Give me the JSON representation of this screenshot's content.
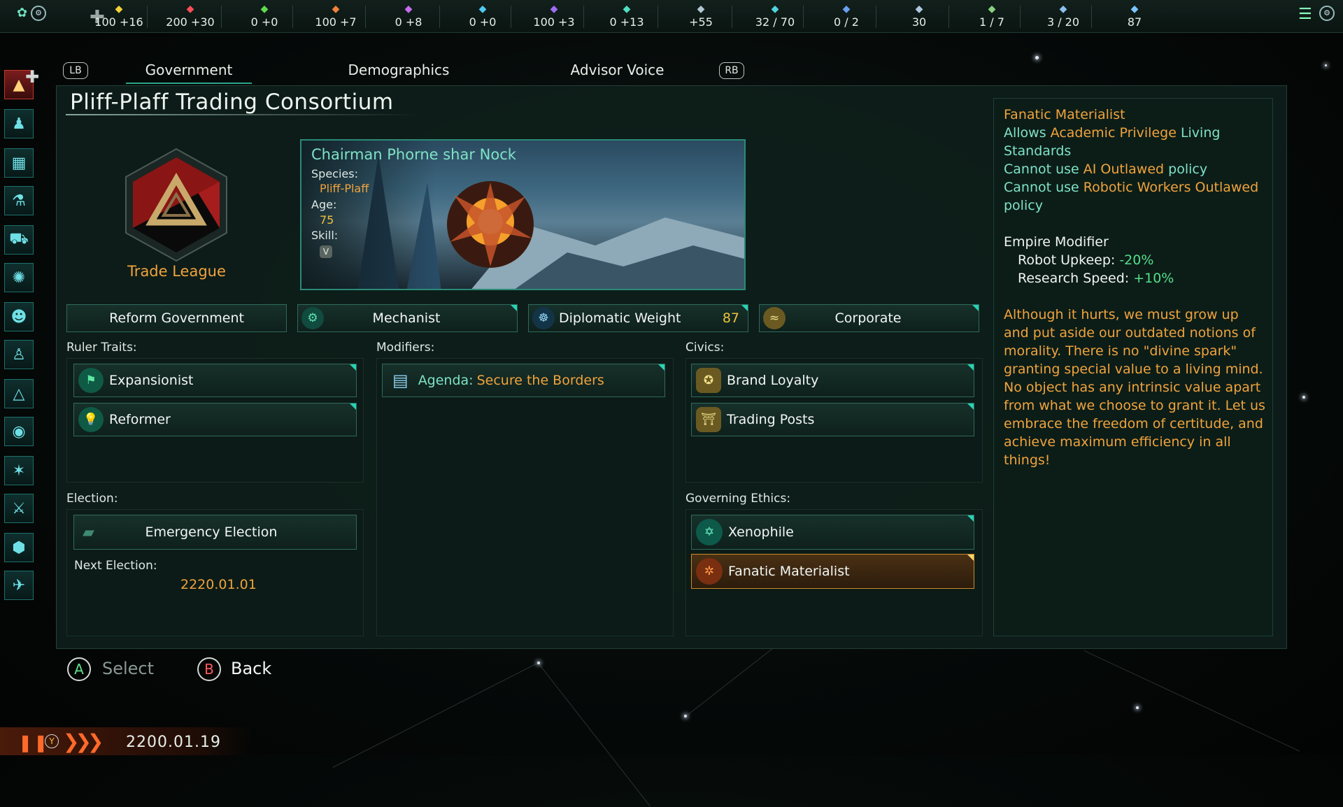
{
  "topbar": {
    "resources": [
      {
        "icon": "energy-icon",
        "value": "100 +16",
        "color": "#f3d23a"
      },
      {
        "icon": "minerals-icon",
        "value": "200 +30",
        "color": "#ff4d57"
      },
      {
        "icon": "food-icon",
        "value": "0 +0",
        "color": "#5fdc4d"
      },
      {
        "icon": "consumer-goods-icon",
        "value": "100 +7",
        "color": "#f0823a"
      },
      {
        "icon": "alloys-icon",
        "value": "0 +8",
        "color": "#c86cf0"
      },
      {
        "icon": "exotic-gases-icon",
        "value": "0 +0",
        "color": "#4fc9f2"
      },
      {
        "icon": "influence-icon",
        "value": "100 +3",
        "color": "#9f6cf7"
      },
      {
        "icon": "unity-icon",
        "value": "0 +13",
        "color": "#4fe0c0"
      },
      {
        "icon": "research-icon",
        "value": "+55",
        "color": "#b0c8d0"
      },
      {
        "icon": "naval-capacity-icon",
        "value": "32 / 70",
        "color": "#4fd4e0"
      },
      {
        "icon": "starbase-icon",
        "value": "0 / 2",
        "color": "#6aa0f0"
      },
      {
        "icon": "pops-icon",
        "value": "30",
        "color": "#b0c8e0"
      },
      {
        "icon": "envoys-icon",
        "value": "1 / 7",
        "color": "#8ad080"
      },
      {
        "icon": "fleets-icon",
        "value": "3 / 20",
        "color": "#8cc0f0"
      },
      {
        "icon": "stability-icon",
        "value": "87",
        "color": "#7cc4ff"
      }
    ]
  },
  "tabs": {
    "lb": "LB",
    "rb": "RB",
    "items": [
      {
        "label": "Government"
      },
      {
        "label": "Demographics"
      },
      {
        "label": "Advisor Voice"
      }
    ]
  },
  "empire": {
    "name": "Pliff-Plaff Trading Consortium",
    "authority": "Trade League"
  },
  "ruler": {
    "title": "Chairman Phorne shar Nock",
    "species_label": "Species:",
    "species": "Pliff-Plaff",
    "age_label": "Age:",
    "age": "75",
    "skill_label": "Skill:",
    "skill": "V"
  },
  "actions": {
    "reform": "Reform Government",
    "mechanist": "Mechanist",
    "diplomatic_weight_label": "Diplomatic Weight",
    "diplomatic_weight": "87",
    "corporate": "Corporate"
  },
  "sections": {
    "ruler_traits_label": "Ruler Traits:",
    "ruler_traits": [
      {
        "label": "Expansionist"
      },
      {
        "label": "Reformer"
      }
    ],
    "modifiers_label": "Modifiers:",
    "modifier_prefix": "Agenda:",
    "modifier_value": "Secure the Borders",
    "civics_label": "Civics:",
    "civics": [
      {
        "label": "Brand Loyalty"
      },
      {
        "label": "Trading Posts"
      }
    ],
    "election_label": "Election:",
    "election_button": "Emergency Election",
    "next_election_label": "Next Election:",
    "next_election": "2220.01.01",
    "ethics_label": "Governing Ethics:",
    "ethics": [
      {
        "label": "Xenophile"
      },
      {
        "label": "Fanatic Materialist"
      }
    ]
  },
  "info": {
    "heading": "Fanatic Materialist",
    "line1_a": "Allows ",
    "line1_b": "Academic Privilege",
    "line1_c": " Living Standards",
    "line2_a": "Cannot use ",
    "line2_b": "AI Outlawed",
    "line2_c": " policy",
    "line3_a": "Cannot use ",
    "line3_b": "Robotic Workers Outlawed",
    "line3_c": " policy",
    "modifier_heading": "Empire Modifier",
    "mod1_label": "Robot Upkeep:",
    "mod1_value": "-20%",
    "mod2_label": "Research Speed:",
    "mod2_value": "+10%",
    "flavor": "Although it hurts, we must grow up and put aside our outdated notions of morality. There is no \"divine spark\" granting special value to a living mind. No object has any intrinsic value apart from what we choose to grant it. Let us embrace the freedom of certitude, and achieve maximum efficiency in all things!"
  },
  "footer": {
    "a_glyph": "A",
    "select": "Select",
    "b_glyph": "B",
    "back": "Back"
  },
  "bottombar": {
    "y_glyph": "Y",
    "date": "2200.01.19"
  }
}
